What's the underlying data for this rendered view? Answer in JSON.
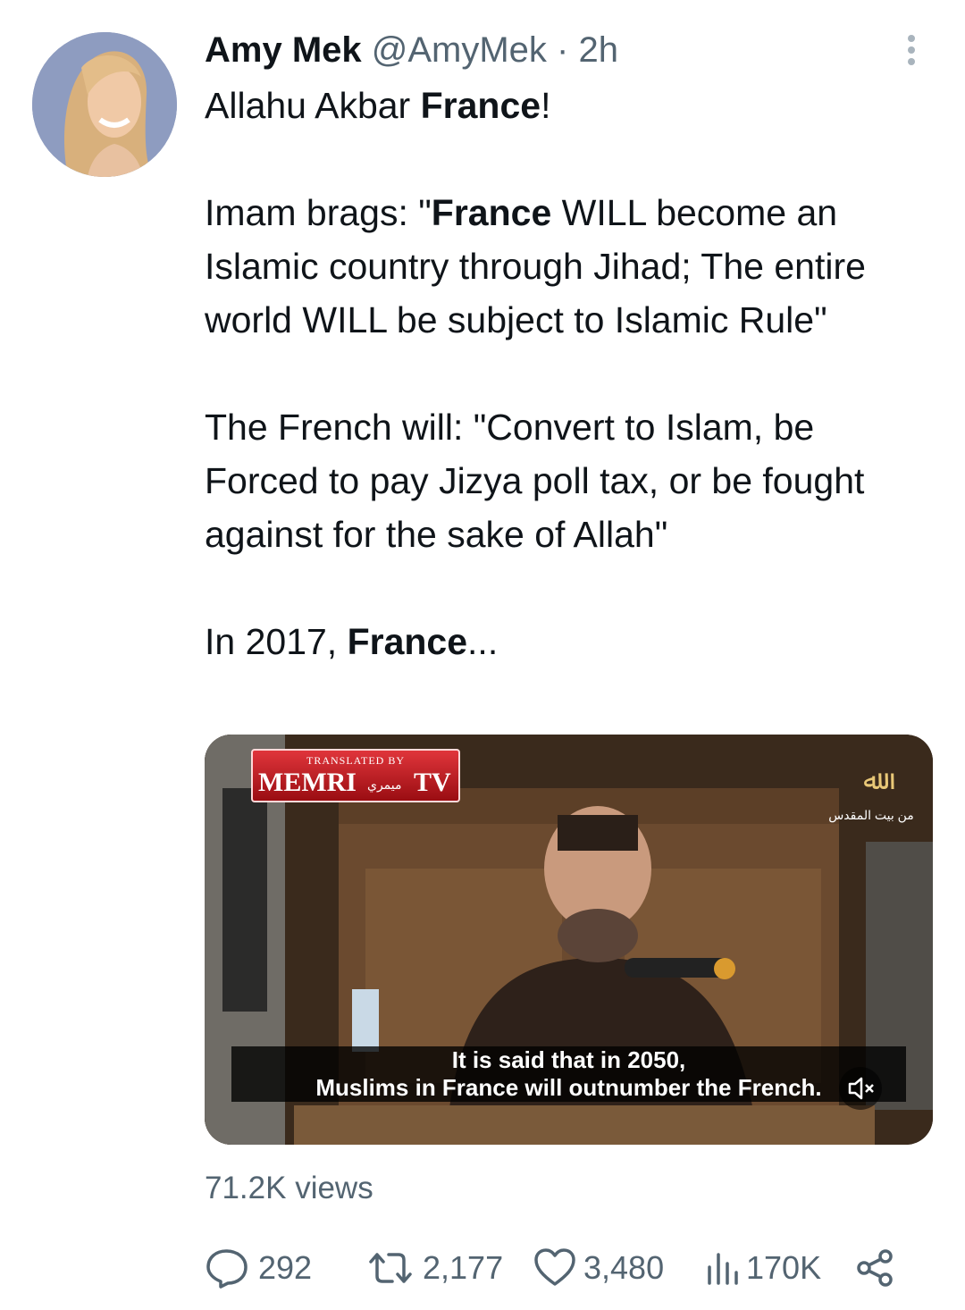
{
  "tweet": {
    "author_name": "Amy Mek",
    "handle": "@AmyMek",
    "separator": "·",
    "time": "2h",
    "line1_a": "Allahu Akbar ",
    "line1_b": "France",
    "line1_c": "!",
    "p2_a": "Imam brags: \"",
    "p2_b": "France",
    "p2_c": " WILL become an Islamic country through Jihad; The entire world WILL be subject to Islamic Rule\"",
    "p3": "The French will:  \"Convert to Islam, be Forced to pay Jizya poll tax, or be fought against for the sake of Allah\"",
    "p4_a": "In 2017, ",
    "p4_b": "France",
    "p4_c": "..."
  },
  "video": {
    "memri_small": "TRANSLATED BY",
    "memri_main": "MEMRI",
    "memri_arabic": "ميمري",
    "memri_tv": "TV",
    "channel_sub": "من بيت المقدس",
    "subtitle_line1": "It is said that in 2050,",
    "subtitle_line2": "Muslims in France will outnumber the French."
  },
  "stats": {
    "views": "71.2K views",
    "replies": "292",
    "retweets": "2,177",
    "likes": "3,480",
    "analytics": "170K"
  },
  "icons": [
    "more-icon",
    "reply-icon",
    "retweet-icon",
    "like-icon",
    "analytics-icon",
    "share-icon",
    "mute-icon"
  ],
  "colors": {
    "text": "#0f1419",
    "secondary": "#536471",
    "memri_red": "#c8161d"
  }
}
